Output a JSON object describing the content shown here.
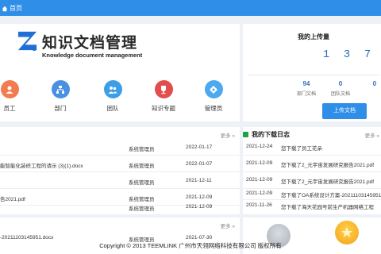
{
  "breadcrumb": {
    "home_label": "首页"
  },
  "logo": {
    "title": "知识文档管理",
    "subtitle": "Knowledge document management"
  },
  "nav": [
    {
      "label": "员工",
      "color": "#f27b4f",
      "icon": "user-icon"
    },
    {
      "label": "部门",
      "color": "#4a90e2",
      "icon": "department-icon"
    },
    {
      "label": "团队",
      "color": "#3d9ee8",
      "icon": "team-icon"
    },
    {
      "label": "知识专题",
      "color": "#e34d4d",
      "icon": "trophy-icon"
    },
    {
      "label": "管理员",
      "color": "#4da9ee",
      "icon": "admin-icon"
    }
  ],
  "upload": {
    "title": "我的上传量",
    "digits": [
      "1",
      "3",
      "7"
    ],
    "stats": [
      {
        "value": "94",
        "label": "部门文档"
      },
      {
        "value": "0",
        "label": "团队文档"
      },
      {
        "value": "0",
        "label": ""
      }
    ],
    "button_label": "上传文档"
  },
  "doc_list": {
    "more_label": "更多 »",
    "rows": [
      {
        "title": "",
        "owner": "系统管理员",
        "date": "2022-01-17"
      },
      {
        "title": "能智能化装修工程的请示 (3)(1).docx",
        "owner": "系统管理员",
        "date": "2022-01-07"
      },
      {
        "title": "",
        "owner": "系统管理员",
        "date": "2021-12-11"
      },
      {
        "title": "告2021.pdf",
        "owner": "系统管理员",
        "date": "2021-12-09"
      },
      {
        "title": "",
        "owner": "系统管理员",
        "date": "2021-12-09"
      }
    ]
  },
  "download_log": {
    "title": "我的下载日志",
    "more_label": "更多 »",
    "rows": [
      {
        "date": "2021-12-24",
        "text": "您下载了员工花朵"
      },
      {
        "date": "2021-12-09",
        "text": "您下载了2_元宇宙发展研究报告2021.pdf"
      },
      {
        "date": "2021-12-09",
        "text": "您下载了2_元宇宙发展研究报告2021.pdf"
      },
      {
        "date": "2021-12-09",
        "text": "您下载了OA系统设计方案-20211103145951"
      },
      {
        "date": "2021-11-26",
        "text": "您下载了海天花园号前生产机器网络工程"
      }
    ]
  },
  "doc_list2": {
    "more_label": "更多 »",
    "rows": [
      {
        "title": "-20211103145951.docx",
        "owner": "系统管理员",
        "date": "2021-07-30"
      }
    ]
  },
  "footer": "Copyright © 2013 TEEMLINK 广州市天翎网络科技有限公司 版权所有",
  "colors": {
    "accent": "#2e8ee8",
    "digit": "#2e6fbf",
    "log_marker": "#1aa34a"
  }
}
